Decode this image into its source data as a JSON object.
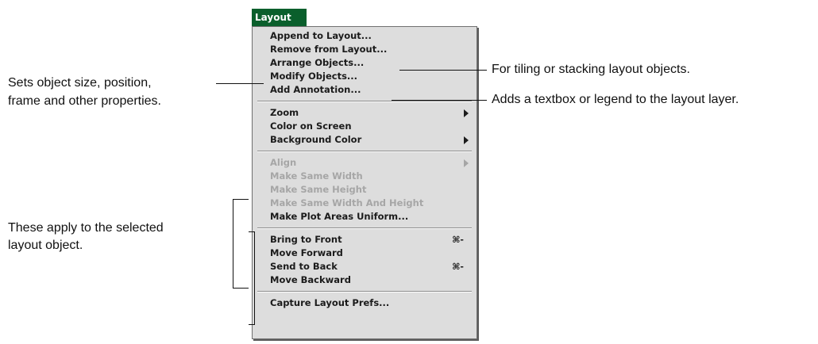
{
  "menu": {
    "title": "Layout",
    "items": [
      {
        "label": "Append to Layout..."
      },
      {
        "label": "Remove from Layout..."
      },
      {
        "label": "Arrange Objects..."
      },
      {
        "label": "Modify Objects..."
      },
      {
        "label": "Add Annotation..."
      },
      {
        "label": "Zoom"
      },
      {
        "label": "Color on Screen"
      },
      {
        "label": "Background Color"
      },
      {
        "label": "Align"
      },
      {
        "label": "Make Same Width"
      },
      {
        "label": "Make Same Height"
      },
      {
        "label": "Make Same Width And Height"
      },
      {
        "label": "Make Plot Areas Uniform..."
      },
      {
        "label": "Bring to Front",
        "shortcut": "⌘-"
      },
      {
        "label": "Move Forward"
      },
      {
        "label": "Send to Back",
        "shortcut": "⌘-"
      },
      {
        "label": "Move Backward"
      },
      {
        "label": "Capture Layout Prefs..."
      }
    ]
  },
  "callouts": {
    "modify_line1": "Sets object size, position,",
    "modify_line2": "frame and other properties.",
    "arrange": "For tiling or stacking layout objects.",
    "annotation": "Adds a textbox or legend to the layout layer.",
    "selected_line1": "These apply to the selected",
    "selected_line2": "layout object."
  }
}
